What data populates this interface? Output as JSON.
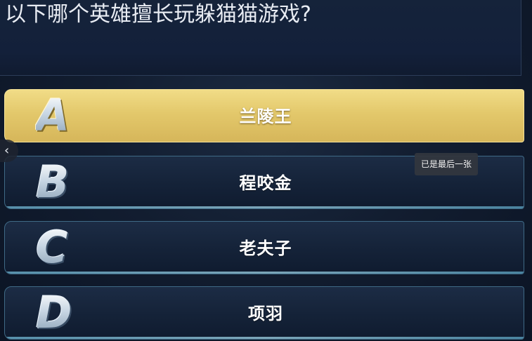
{
  "question": {
    "text": "以下哪个英雄擅长玩躲猫猫游戏?"
  },
  "options": [
    {
      "letter": "A",
      "label": "兰陵王",
      "state": "selected"
    },
    {
      "letter": "B",
      "label": "程咬金",
      "state": "normal"
    },
    {
      "letter": "C",
      "label": "老夫子",
      "state": "normal"
    },
    {
      "letter": "D",
      "label": "项羽",
      "state": "normal"
    }
  ],
  "nav": {
    "prev_icon": "chevron-left-icon",
    "prev_glyph": "‹"
  },
  "tooltip": {
    "text": "已是最后一张"
  },
  "colors": {
    "selected": "#e3c86b",
    "option_bg": "#152339",
    "option_border": "#3f6a86",
    "background": "#0f1a2c"
  }
}
